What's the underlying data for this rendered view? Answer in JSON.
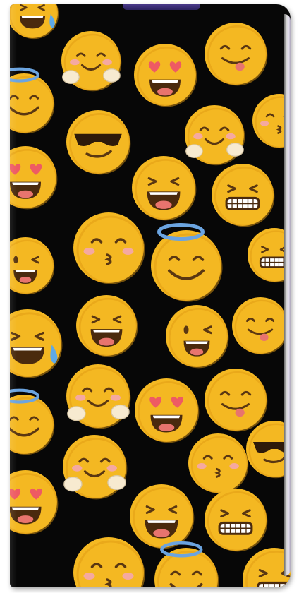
{
  "product": "phone-flip-case",
  "pattern": "emoji-faces",
  "colors": {
    "background": "#070707",
    "face": "#F4B822",
    "face_shade": "#E09A12",
    "features": "#5A3712",
    "mouth": "#4A2A0E",
    "tongue": "#E8746E",
    "heart": "#EE5B63",
    "blush": "#F5A9A0",
    "halo": "#6BA4E0",
    "tear": "#5EA9E8",
    "hands": "#F7EAD0",
    "sunglasses": "#2E1A0A"
  },
  "emojis": [
    {
      "name": "tear-joy-emoji-icon",
      "type": "tearjoy"
    },
    {
      "name": "hug-emoji-icon",
      "type": "hug"
    },
    {
      "name": "heart-eyes-emoji-icon",
      "type": "hearteyes"
    },
    {
      "name": "tongue-emoji-icon",
      "type": "tongue"
    },
    {
      "name": "halo-emoji-icon",
      "type": "halo"
    },
    {
      "name": "sunglasses-emoji-icon",
      "type": "sunglasses"
    },
    {
      "name": "hug-emoji-icon",
      "type": "hug"
    },
    {
      "name": "kiss-emoji-icon",
      "type": "kiss"
    },
    {
      "name": "heart-eyes-emoji-icon",
      "type": "hearteyes"
    },
    {
      "name": "laugh-emoji-icon",
      "type": "laugh"
    },
    {
      "name": "grin-emoji-icon",
      "type": "grin"
    },
    {
      "name": "kiss-emoji-icon",
      "type": "kiss"
    },
    {
      "name": "halo-emoji-icon",
      "type": "halo"
    },
    {
      "name": "grin-emoji-icon",
      "type": "grin"
    },
    {
      "name": "wink-emoji-icon",
      "type": "wink"
    },
    {
      "name": "tear-joy-emoji-icon",
      "type": "tearjoy"
    },
    {
      "name": "laugh-emoji-icon",
      "type": "laugh"
    },
    {
      "name": "wink-emoji-icon",
      "type": "wink"
    },
    {
      "name": "tongue-emoji-icon",
      "type": "tongue"
    },
    {
      "name": "hug-emoji-icon",
      "type": "hug"
    },
    {
      "name": "heart-eyes-emoji-icon",
      "type": "hearteyes"
    },
    {
      "name": "tongue-emoji-icon",
      "type": "tongue"
    },
    {
      "name": "halo-emoji-icon",
      "type": "halo"
    },
    {
      "name": "sunglasses-emoji-icon",
      "type": "sunglasses"
    },
    {
      "name": "hug-emoji-icon",
      "type": "hug"
    },
    {
      "name": "kiss-emoji-icon",
      "type": "kiss"
    },
    {
      "name": "heart-eyes-emoji-icon",
      "type": "hearteyes"
    },
    {
      "name": "laugh-emoji-icon",
      "type": "laugh"
    },
    {
      "name": "grin-emoji-icon",
      "type": "grin"
    },
    {
      "name": "kiss-emoji-icon",
      "type": "kiss"
    },
    {
      "name": "halo-emoji-icon",
      "type": "halo"
    },
    {
      "name": "grin-emoji-icon",
      "type": "grin"
    }
  ]
}
